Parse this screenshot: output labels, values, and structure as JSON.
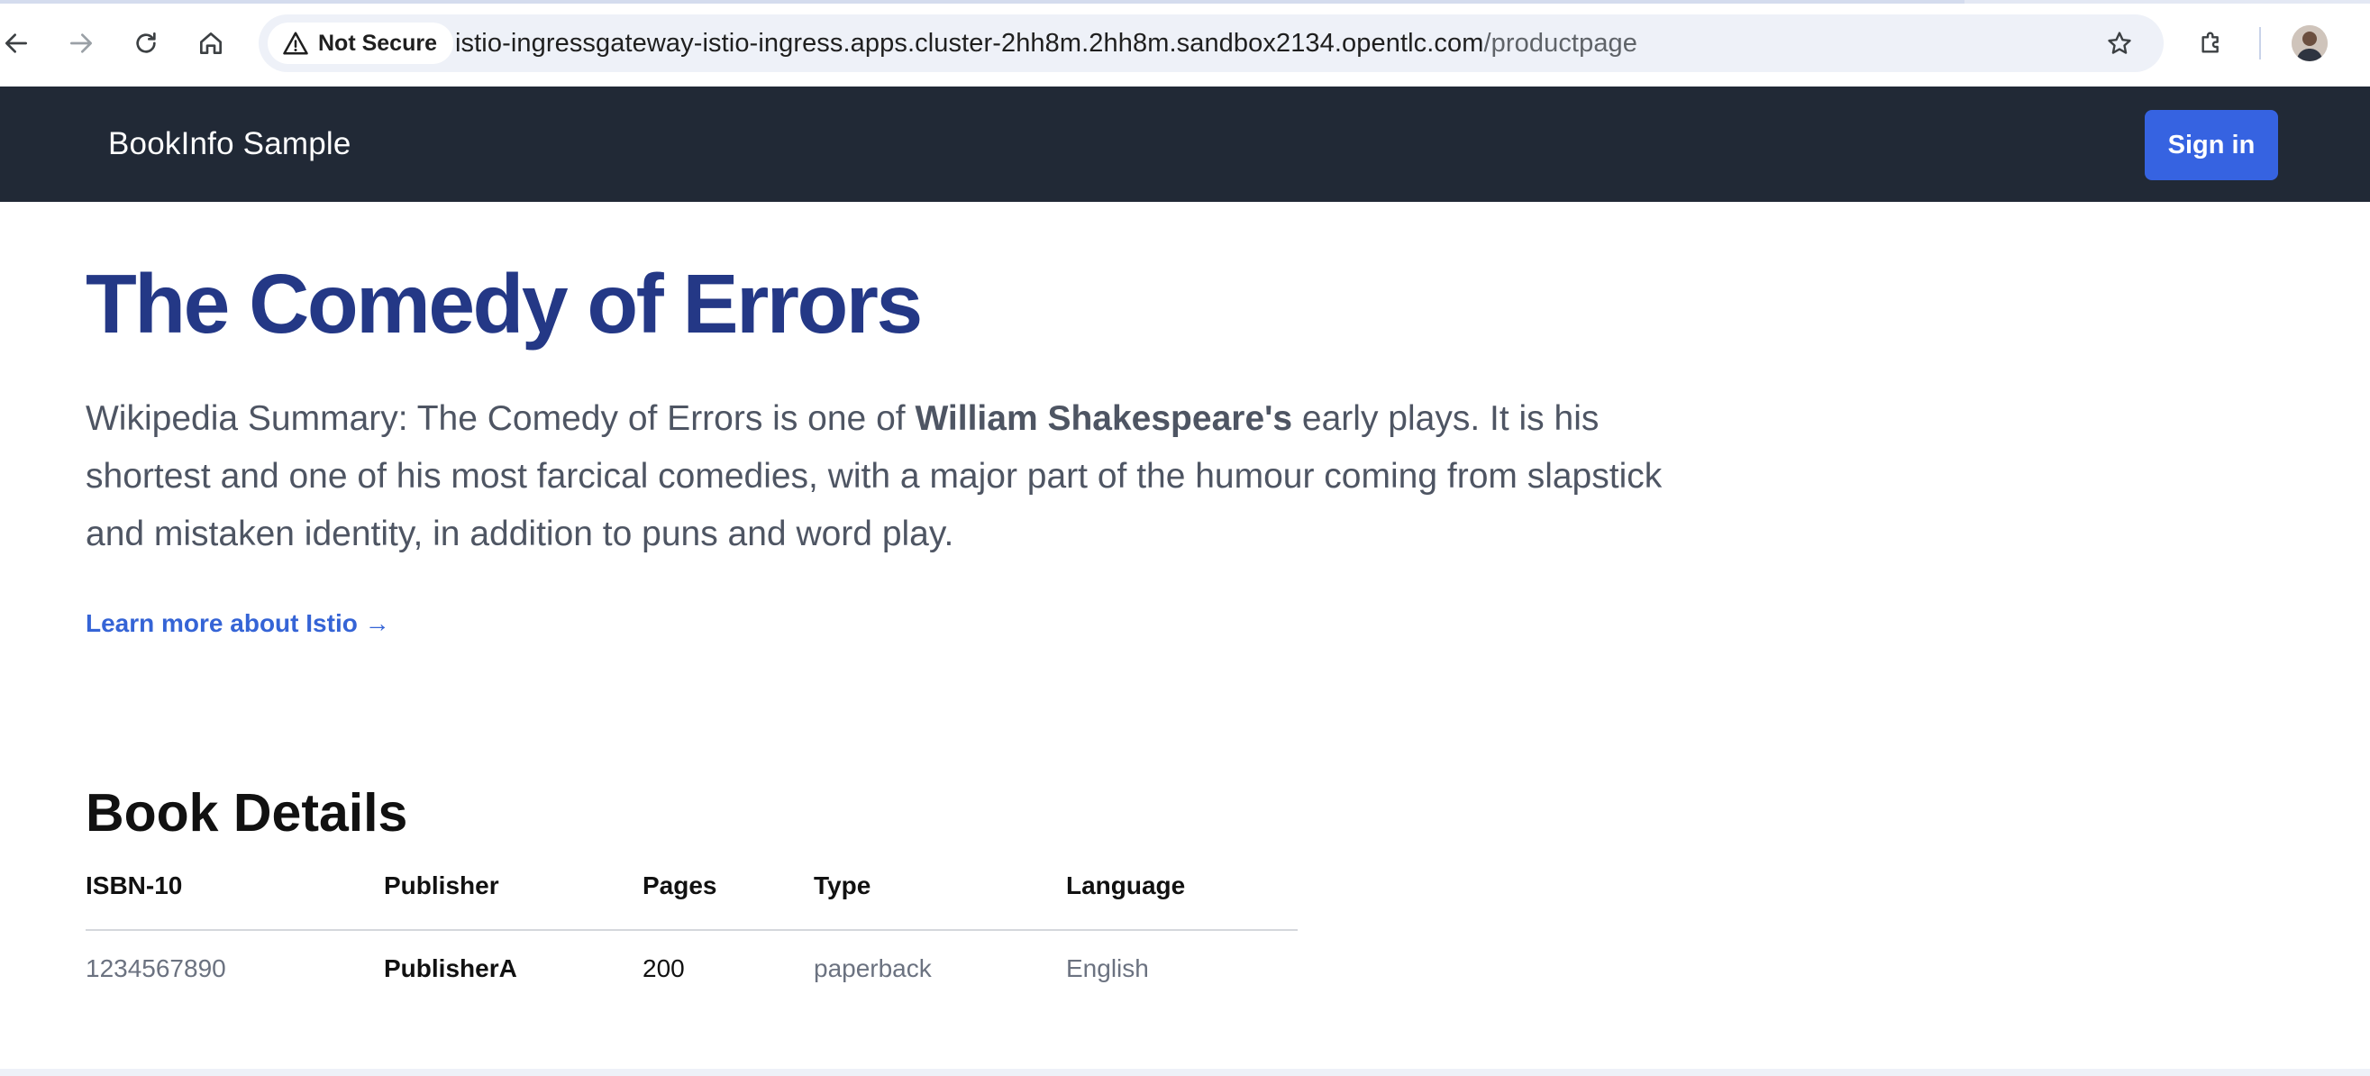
{
  "browser": {
    "security_chip": "Not Secure",
    "url_host": "istio-ingressgateway-istio-ingress.apps.cluster-2hh8m.2hh8m.sandbox2134.opentlc.com",
    "url_path": "/productpage",
    "icons": [
      "back-arrow-icon",
      "forward-arrow-icon",
      "reload-icon",
      "home-icon",
      "warning-triangle-icon",
      "star-icon",
      "puzzle-icon",
      "avatar"
    ]
  },
  "header": {
    "brand": "BookInfo Sample",
    "sign_in_label": "Sign in"
  },
  "product": {
    "title": "The Comedy of Errors",
    "summary_prefix": "Wikipedia Summary: The Comedy of Errors is one of ",
    "summary_bold": "William Shakespeare's",
    "summary_suffix": " early plays. It is his shortest and one of his most farcical comedies, with a major part of the humour coming from slapstick and mistaken identity, in addition to puns and word play.",
    "learn_more": "Learn more about Istio →"
  },
  "details": {
    "heading": "Book Details",
    "columns": [
      "ISBN-10",
      "Publisher",
      "Pages",
      "Type",
      "Language"
    ],
    "row": {
      "isbn": "1234567890",
      "publisher": "PublisherA",
      "pages": "200",
      "type": "paperback",
      "language": "English"
    }
  },
  "colors": {
    "header_bg": "#212936",
    "title": "#243886",
    "accent_button": "#3663e1",
    "link": "#3564d6"
  }
}
